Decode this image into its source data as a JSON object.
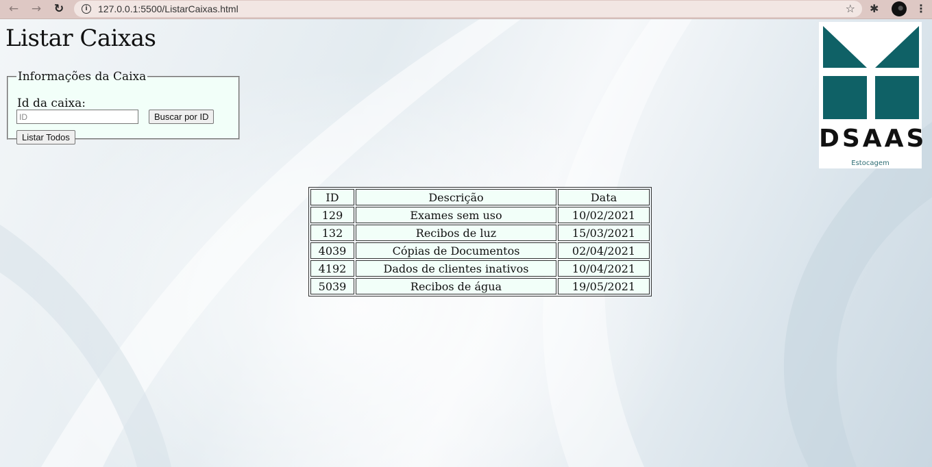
{
  "browser": {
    "url": "127.0.0.1:5500/ListarCaixas.html",
    "back_icon": "back-arrow-icon",
    "forward_icon": "forward-arrow-icon",
    "reload_icon": "reload-icon"
  },
  "page": {
    "title": "Listar Caixas",
    "form": {
      "legend": "Informações da Caixa",
      "id_label": "Id da caixa:",
      "id_placeholder": "ID",
      "id_value": "",
      "search_button": "Buscar por ID",
      "list_all_button": "Listar Todos"
    },
    "logo": {
      "wordmark": "DSAAS",
      "subtitle": "Estocagem",
      "color": "#0f6166"
    },
    "table": {
      "headers": [
        "ID",
        "Descrição",
        "Data"
      ],
      "rows": [
        {
          "id": "129",
          "descricao": "Exames sem uso",
          "data": "10/02/2021"
        },
        {
          "id": "132",
          "descricao": "Recibos de luz",
          "data": "15/03/2021"
        },
        {
          "id": "4039",
          "descricao": "Cópias de Documentos",
          "data": "02/04/2021"
        },
        {
          "id": "4192",
          "descricao": "Dados de clientes inativos",
          "data": "10/04/2021"
        },
        {
          "id": "5039",
          "descricao": "Recibos de água",
          "data": "19/05/2021"
        }
      ]
    }
  }
}
